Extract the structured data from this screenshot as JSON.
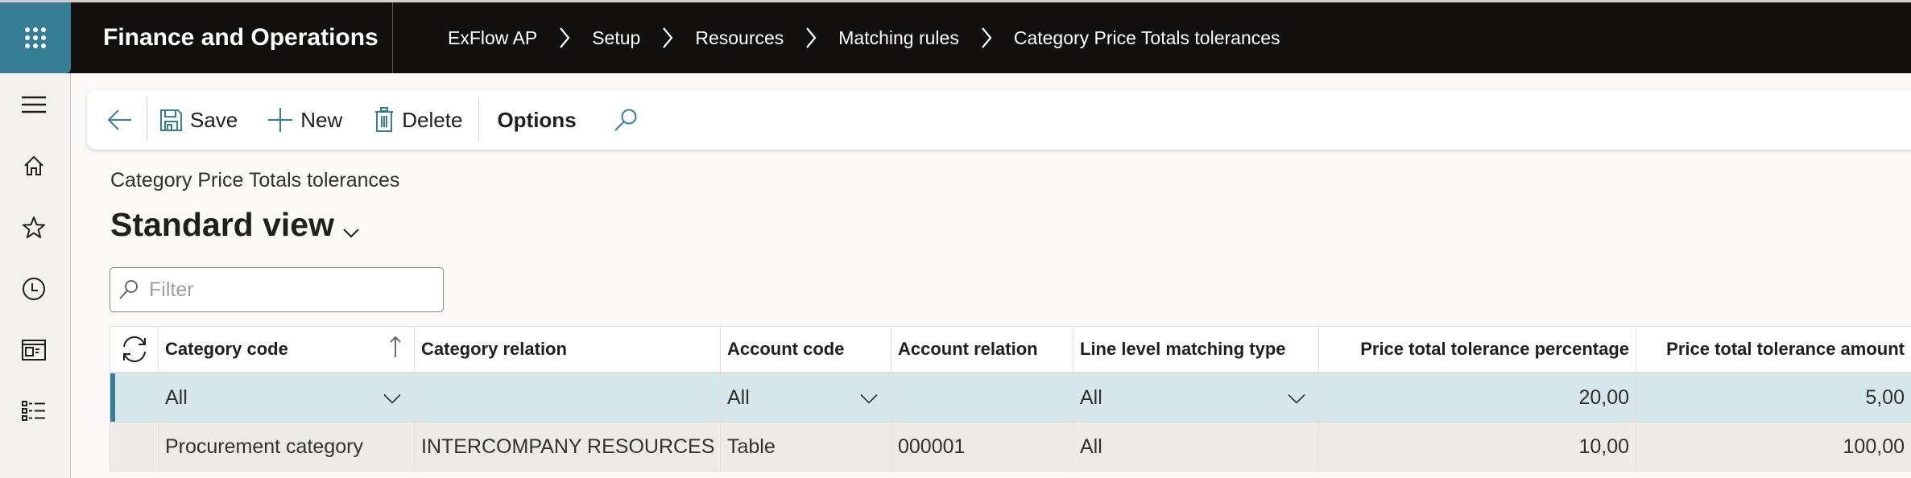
{
  "app": {
    "title": "Finance and Operations",
    "waffle_icon": "app-launcher-icon"
  },
  "breadcrumb": [
    {
      "label": "ExFlow AP"
    },
    {
      "label": "Setup"
    },
    {
      "label": "Resources"
    },
    {
      "label": "Matching rules"
    },
    {
      "label": "Category Price Totals tolerances"
    }
  ],
  "rail": {
    "items": [
      {
        "name": "menu",
        "icon": "hamburger-icon"
      },
      {
        "name": "home",
        "icon": "home-icon"
      },
      {
        "name": "favorites",
        "icon": "star-icon"
      },
      {
        "name": "recent",
        "icon": "clock-icon"
      },
      {
        "name": "workspaces",
        "icon": "workspace-icon"
      },
      {
        "name": "modules",
        "icon": "list-icon"
      }
    ]
  },
  "actionpane": {
    "back_icon": "back-arrow-icon",
    "save_label": "Save",
    "new_label": "New",
    "delete_label": "Delete",
    "options_label": "Options",
    "search_icon": "search-icon"
  },
  "page": {
    "caption": "Category Price Totals tolerances",
    "view_name": "Standard view"
  },
  "filter": {
    "placeholder": "Filter",
    "value": ""
  },
  "grid": {
    "columns": [
      {
        "key": "category_code",
        "label": "Category code",
        "sorted": "ascending"
      },
      {
        "key": "category_relation",
        "label": "Category relation"
      },
      {
        "key": "account_code",
        "label": "Account code"
      },
      {
        "key": "account_relation",
        "label": "Account relation"
      },
      {
        "key": "line_level_matching_type",
        "label": "Line level matching type"
      },
      {
        "key": "price_total_tolerance_percentage",
        "label": "Price total tolerance percentage"
      },
      {
        "key": "price_total_tolerance_amount",
        "label": "Price total tolerance amount"
      }
    ],
    "rows": [
      {
        "selected": true,
        "category_code": "All",
        "category_relation": "",
        "account_code": "All",
        "account_relation": "",
        "line_level_matching_type": "All",
        "price_total_tolerance_percentage": "20,00",
        "price_total_tolerance_amount": "5,00"
      },
      {
        "selected": false,
        "category_code": "Procurement category",
        "category_relation": "INTERCOMPANY RESOURCES",
        "account_code": "Table",
        "account_relation": "000001",
        "line_level_matching_type": "All",
        "price_total_tolerance_percentage": "10,00",
        "price_total_tolerance_amount": "100,00"
      }
    ]
  },
  "colors": {
    "accent": "#367d96",
    "topbar": "#11100f",
    "selected_row": "#d5e7eb",
    "alt_row": "#edebe9"
  }
}
